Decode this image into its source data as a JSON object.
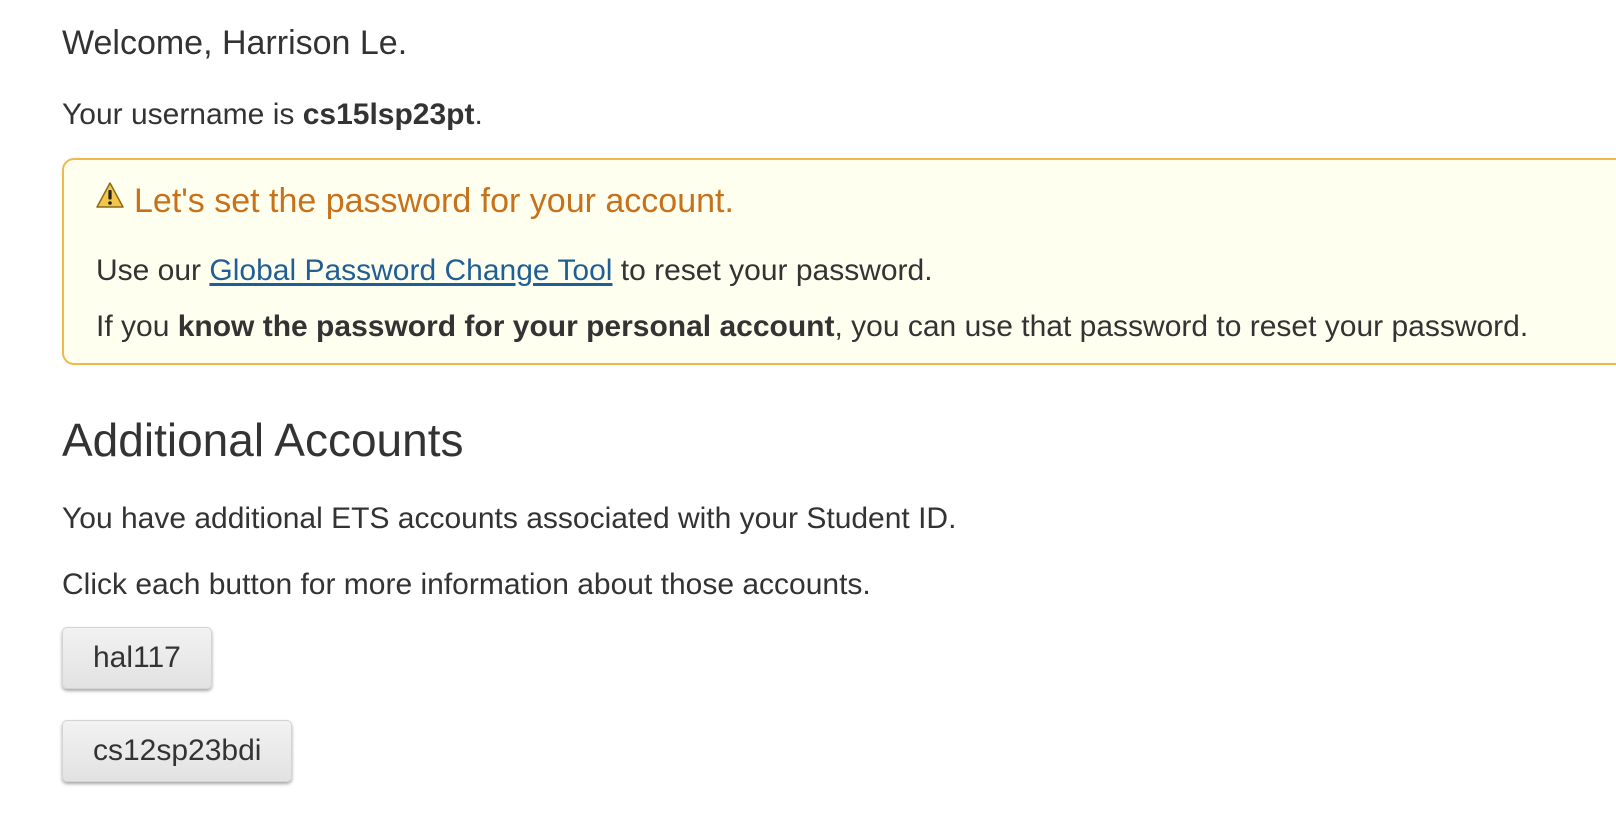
{
  "welcome": {
    "text": "Welcome, Harrison Le."
  },
  "username": {
    "prefix": "Your username is ",
    "value": "cs15lsp23pt",
    "suffix": "."
  },
  "alert": {
    "title": "Let's set the password for your account.",
    "line1_prefix": "Use our ",
    "line1_link": "Global Password Change Tool",
    "line1_suffix": " to reset your password.",
    "line2_prefix": "If you ",
    "line2_bold": "know the password for your personal account",
    "line2_suffix": ", you can use that password to reset your password.",
    "icon": "warning-icon",
    "title_color": "#c8711b",
    "border_color": "#f0b849",
    "background": "#fffff0",
    "link_color": "#1f5f95"
  },
  "additional_accounts": {
    "heading": "Additional Accounts",
    "para1": "You have additional ETS accounts associated with your Student ID.",
    "para2": "Click each button for more information about those accounts.",
    "buttons": [
      {
        "label": "hal117"
      },
      {
        "label": "cs12sp23bdi"
      }
    ]
  }
}
